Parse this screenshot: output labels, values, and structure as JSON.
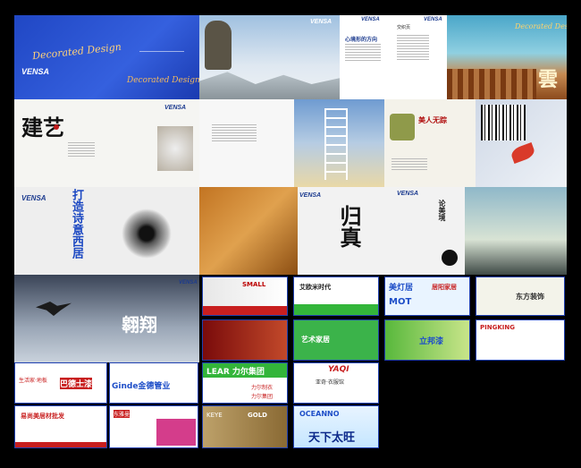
{
  "brand_logo": "VENSA",
  "tiles": {
    "deco_script": "Decorated Design",
    "xinji_title": "心境形的方向",
    "jiaozhiye_title": "交织页",
    "jianyi": "建艺",
    "meiren_calligraphy": "美人无踪",
    "daqiang_title": "打造诗意西居",
    "fei_calligraphy": "归真",
    "jingjian_title": "论美境",
    "feixiang": "翱翔"
  },
  "cards": {
    "c1": "SMALL",
    "c2": "艾欧米时代",
    "c3": "美灯居",
    "c3_sub": "MOT",
    "c3_tag": "居阳家居",
    "c4": "东方装饰",
    "c5": "艺术家居",
    "c6": "立邦漆",
    "c7": "PINGKING",
    "c8": "生活家·地板",
    "c8_brand": "巴德士漆",
    "c9": "Ginde金德管业",
    "c10": "LEAR 力尔集团",
    "c10_a": "力尔制衣",
    "c10_b": "力尔集团",
    "c11": "YAQI",
    "c11_sub": "亚奇·衣服馆",
    "c12": "易尚美居材批发",
    "c13": "东雅曼",
    "c14": "KEYE",
    "c14_sub": "GOLD",
    "c15": "OCEANNO",
    "c15_sub": "天下太旺"
  },
  "colors": {
    "blue": "#1f4fc8",
    "dark_blue": "#0d2a8a",
    "red": "#c81f1f",
    "green": "#33b53a"
  }
}
